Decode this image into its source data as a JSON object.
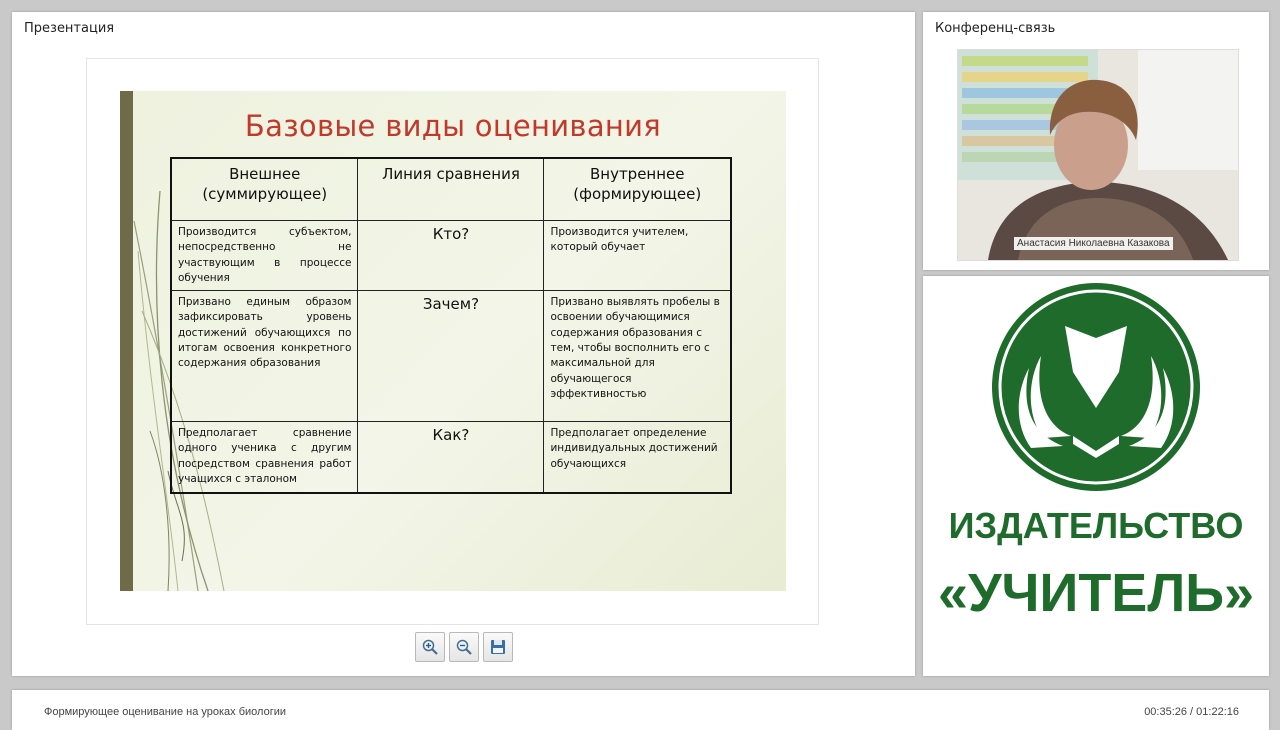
{
  "presentation": {
    "panel_title": "Презентация",
    "slide": {
      "title": "Базовые виды оценивания",
      "table": {
        "headers": [
          "Внешнее\n(суммирующее)",
          "Линия сравнения",
          "Внутреннее\n(формирующее)"
        ],
        "rows": [
          [
            "Производится субъектом, непосредственно не участвующим в процессе обучения",
            "Кто?",
            "Производится учителем, который обучает"
          ],
          [
            "Призвано единым образом зафиксировать уровень достижений обучающихся по итогам освоения конкретного содержания образования",
            "Зачем?",
            "Призвано выявлять пробелы в освоении обучающимися содержания образования с тем, чтобы восполнить его с максимальной для обучающегося эффективностью"
          ],
          [
            "Предполагает сравнение одного ученика с другим посредством сравнения работ учащихся с эталоном",
            "Как?",
            "Предполагает определение индивидуальных достижений обучающихся"
          ]
        ]
      }
    },
    "toolbar": {
      "zoom_in_icon": "zoom-in-icon",
      "zoom_out_icon": "zoom-out-icon",
      "save_icon": "floppy-disk-icon"
    }
  },
  "conference": {
    "panel_title": "Конференц-связь",
    "speaker_name": "Анастасия Николаевна Казакова"
  },
  "logo": {
    "line1": "ИЗДАТЕЛЬСТВО",
    "line2": "«УЧИТЕЛЬ»",
    "color": "#1e6b2c"
  },
  "footer": {
    "title": "Формирующее оценивание на уроках биологии",
    "time": "00:35:26 / 01:22:16"
  }
}
